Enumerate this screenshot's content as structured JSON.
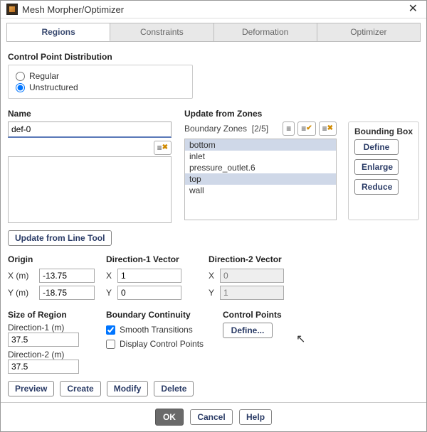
{
  "window": {
    "title": "Mesh Morpher/Optimizer"
  },
  "tabs": [
    {
      "label": "Regions",
      "active": true
    },
    {
      "label": "Constraints"
    },
    {
      "label": "Deformation"
    },
    {
      "label": "Optimizer"
    }
  ],
  "cpd": {
    "heading": "Control Point Distribution",
    "regular_label": "Regular",
    "unstructured_label": "Unstructured",
    "selected": "unstructured"
  },
  "name": {
    "heading": "Name",
    "value": "def-0"
  },
  "zones": {
    "heading": "Update from Zones",
    "list_label": "Boundary Zones",
    "selected_count": "[2/5]",
    "items": [
      {
        "label": "bottom",
        "selected": true
      },
      {
        "label": "inlet",
        "selected": false
      },
      {
        "label": "pressure_outlet.6",
        "selected": false
      },
      {
        "label": "top",
        "selected": true
      },
      {
        "label": "wall",
        "selected": false
      }
    ]
  },
  "bb": {
    "heading": "Bounding Box",
    "define": "Define",
    "enlarge": "Enlarge",
    "reduce": "Reduce"
  },
  "line_tool": {
    "label": "Update from Line Tool"
  },
  "origin": {
    "heading": "Origin",
    "x_label": "X (m)",
    "x_value": "-13.75",
    "y_label": "Y (m)",
    "y_value": "-18.75"
  },
  "dir1": {
    "heading": "Direction-1 Vector",
    "x_label": "X",
    "x_value": "1",
    "y_label": "Y",
    "y_value": "0"
  },
  "dir2": {
    "heading": "Direction-2 Vector",
    "x_label": "X",
    "x_value": "0",
    "y_label": "Y",
    "y_value": "1"
  },
  "size": {
    "heading": "Size of Region",
    "d1_label": "Direction-1 (m)",
    "d1_value": "37.5",
    "d2_label": "Direction-2 (m)",
    "d2_value": "37.5"
  },
  "bc": {
    "heading": "Boundary Continuity",
    "smooth_label": "Smooth Transitions",
    "smooth_checked": true,
    "display_label": "Display Control Points",
    "display_checked": false
  },
  "cp": {
    "heading": "Control Points",
    "define_label": "Define..."
  },
  "actions": {
    "preview": "Preview",
    "create": "Create",
    "modify": "Modify",
    "delete": "Delete"
  },
  "footer": {
    "ok": "OK",
    "cancel": "Cancel",
    "help": "Help"
  }
}
